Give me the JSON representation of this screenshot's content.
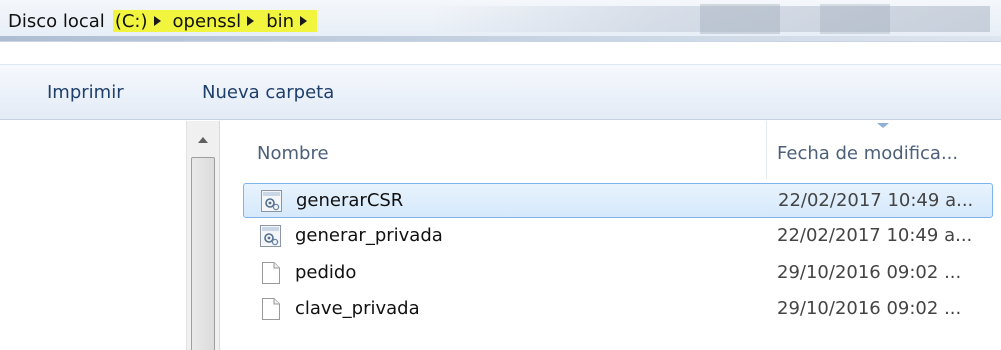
{
  "address": {
    "segments": [
      "Disco local",
      "(C:)",
      "openssl",
      "bin"
    ]
  },
  "toolbar": {
    "print_label": "Imprimir",
    "new_folder_label": "Nueva carpeta"
  },
  "columns": {
    "name": "Nombre",
    "date": "Fecha de modifica..."
  },
  "files": [
    {
      "name": "generarCSR",
      "date": "22/02/2017 10:49 a...",
      "icon": "batch-file-icon",
      "selected": true
    },
    {
      "name": "generar_privada",
      "date": "22/02/2017 10:49 a...",
      "icon": "batch-file-icon",
      "selected": false
    },
    {
      "name": "pedido",
      "date": "29/10/2016 09:02 ...",
      "icon": "blank-file-icon",
      "selected": false
    },
    {
      "name": "clave_privada",
      "date": "29/10/2016 09:02 ...",
      "icon": "blank-file-icon",
      "selected": false
    }
  ],
  "colors": {
    "highlight": "#f2f53e",
    "selection": "#d5e9fb",
    "selection_border": "#7eb4ea"
  }
}
